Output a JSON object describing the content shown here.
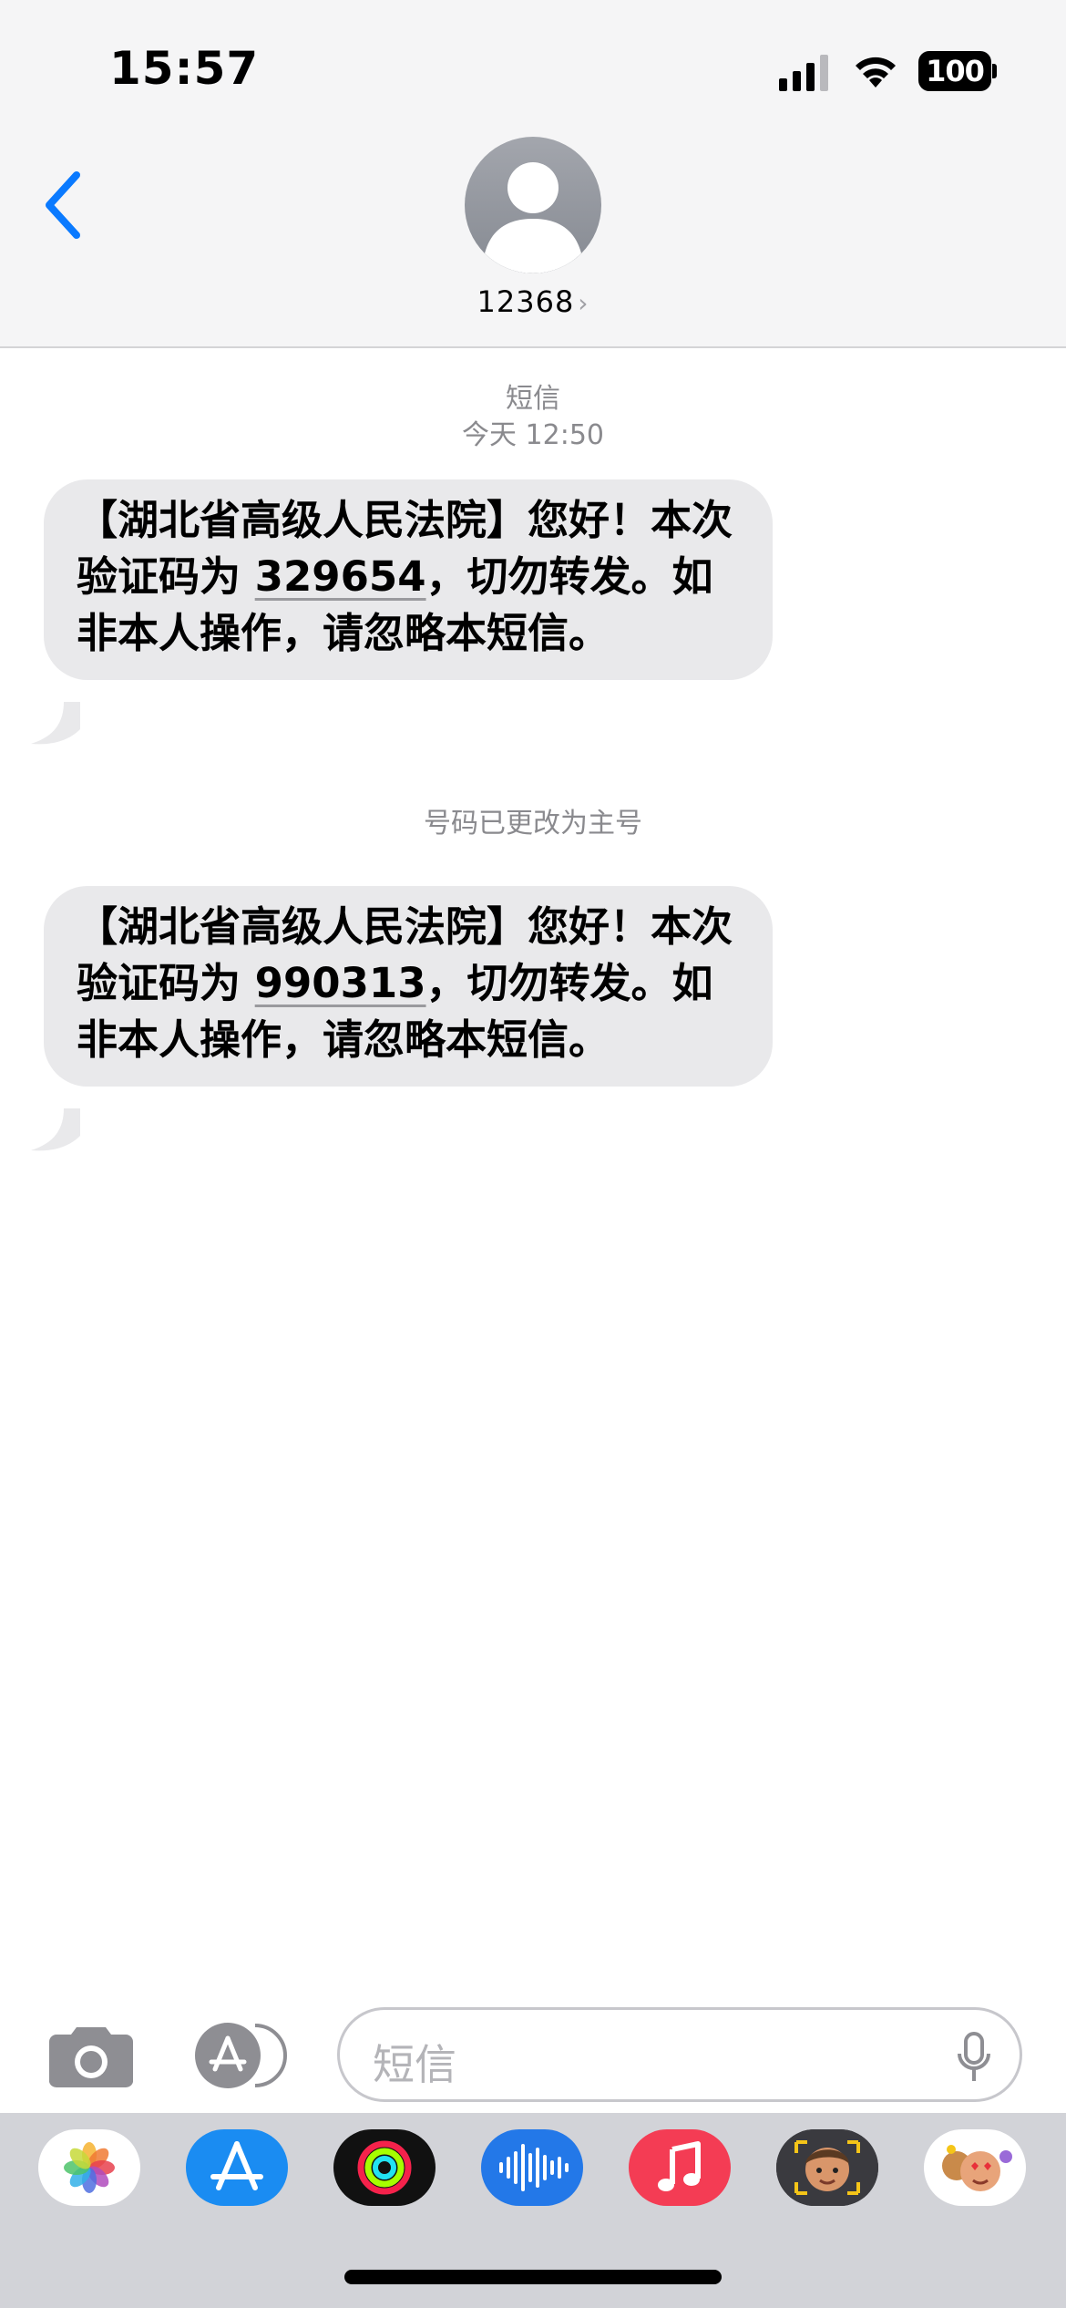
{
  "status_bar": {
    "time": "15:57",
    "battery": "100"
  },
  "contact": {
    "name": "12368",
    "chevron": "›"
  },
  "conversation": {
    "service_label": "短信",
    "timestamp": "今天 12:50",
    "notice": "号码已更改为主号",
    "messages": [
      {
        "before": "【湖北省高级人民法院】您好！本次验证码为 ",
        "code": "329654",
        "after": "，切勿转发。如非本人操作，请忽略本短信。"
      },
      {
        "before": "【湖北省高级人民法院】您好！本次验证码为 ",
        "code": "990313",
        "after": "，切勿转发。如非本人操作，请忽略本短信。"
      }
    ]
  },
  "input": {
    "placeholder": "短信"
  },
  "app_drawer": [
    "photos-icon",
    "app-store-icon",
    "activity-icon",
    "voice-memos-icon",
    "music-icon",
    "memoji-icon",
    "animoji-stickers-icon"
  ],
  "colors": {
    "accent": "#0a7aff",
    "bubble": "#e9e9eb",
    "header": "#f5f5f6",
    "drawer": "#d2d3d8"
  }
}
